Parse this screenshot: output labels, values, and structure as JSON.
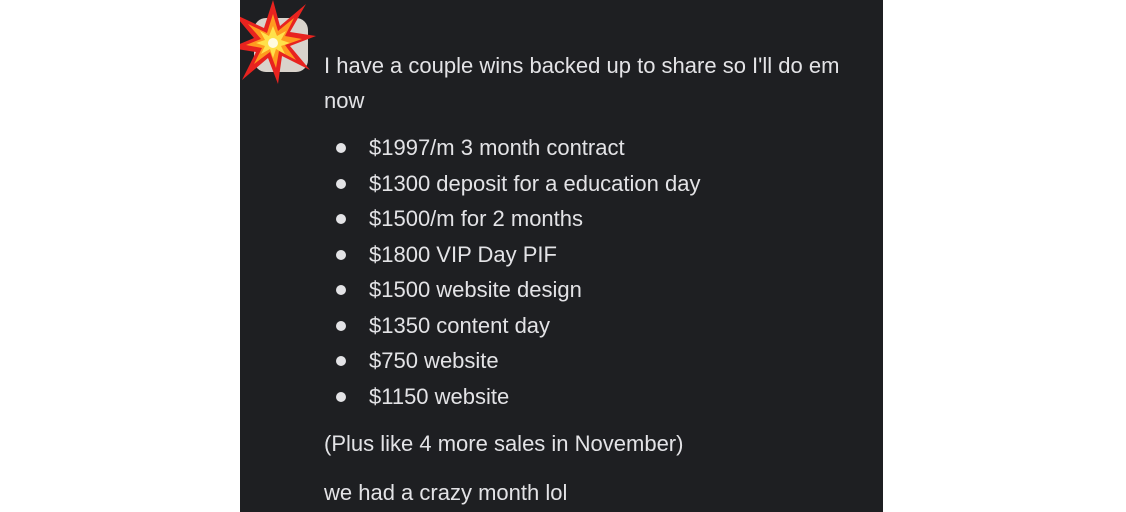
{
  "message": {
    "avatar_icon": "collision-burst-icon",
    "intro": "I have a couple wins backed up to share so I'll do em now",
    "wins": [
      "$1997/m 3 month contract",
      "$1300 deposit for a education day",
      "$1500/m for 2 months",
      "$1800 VIP Day PIF",
      "$1500 website design",
      "$1350 content day",
      "$750 website",
      "$1150 website"
    ],
    "after_list": "(Plus like 4 more sales in November)",
    "closing": "we had a crazy month lol"
  },
  "colors": {
    "panel_background": "#1e1f22",
    "text": "#e3e3e6",
    "burst_red": "#e8231f",
    "burst_yellow": "#ffe14a"
  }
}
